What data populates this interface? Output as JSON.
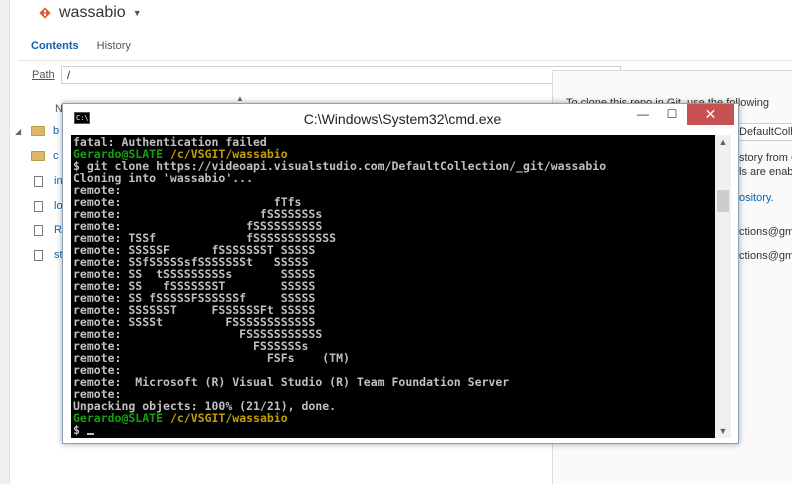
{
  "repo": {
    "name": "wassabio",
    "icon": "git-repo-icon"
  },
  "tabs": [
    {
      "label": "Contents",
      "active": true
    },
    {
      "label": "History",
      "active": false
    }
  ],
  "path": {
    "label": "Path",
    "value": "/"
  },
  "file_list": {
    "column_header": "N",
    "items": [
      {
        "label": "b",
        "type": "folder",
        "expanded": true
      },
      {
        "label": "c",
        "type": "folder"
      },
      {
        "label": "in",
        "type": "file"
      },
      {
        "label": "lo",
        "type": "file"
      },
      {
        "label": "R",
        "type": "file"
      },
      {
        "label": "st",
        "type": "file"
      }
    ]
  },
  "right_panel": {
    "lines": [
      "To clone this repo in Git, use the following",
      "DefaultColl",
      "story from C",
      "ls are enab",
      "ository.",
      "ctions@gm",
      "ctions@gm"
    ]
  },
  "cmd": {
    "title": "C:\\Windows\\System32\\cmd.exe",
    "icon_text": "C:\\",
    "controls": {
      "minimize": "—",
      "maximize": "☐",
      "close": "✕"
    },
    "lines": [
      {
        "text": "fatal: Authentication failed"
      },
      {
        "prompt_user": "Gerardo@SLATE",
        "prompt_path": "/c/VSGIT/wassabio"
      },
      {
        "text": "$ git clone https://videoapi.visualstudio.com/DefaultCollection/_git/wassabio"
      },
      {
        "text": "Cloning into 'wassabio'..."
      },
      {
        "text": "remote:"
      },
      {
        "text": "remote:                      fTfs"
      },
      {
        "text": "remote:                    fSSSSSSSs"
      },
      {
        "text": "remote:                  fSSSSSSSSSS"
      },
      {
        "text": "remote: TSSf             fSSSSSSSSSSSS"
      },
      {
        "text": "remote: SSSSSF      fSSSSSSST SSSSS"
      },
      {
        "text": "remote: SSfSSSSSsfSSSSSSSt   SSSSS"
      },
      {
        "text": "remote: SS  tSSSSSSSSSs       SSSSS"
      },
      {
        "text": "remote: SS   fSSSSSSST        SSSSS"
      },
      {
        "text": "remote: SS fSSSSSFSSSSSSf     SSSSS"
      },
      {
        "text": "remote: SSSSSST     FSSSSSSFt SSSSS"
      },
      {
        "text": "remote: SSSSt         FSSSSSSSSSSSS"
      },
      {
        "text": "remote:                 FSSSSSSSSSSS"
      },
      {
        "text": "remote:                   FSSSSSSs"
      },
      {
        "text": "remote:                     FSFs    (TM)"
      },
      {
        "text": "remote:"
      },
      {
        "text": "remote:  Microsoft (R) Visual Studio (R) Team Foundation Server"
      },
      {
        "text": "remote:"
      },
      {
        "text": "Unpacking objects: 100% (21/21), done."
      },
      {
        "prompt_user": "Gerardo@SLATE",
        "prompt_path": "/c/VSGIT/wassabio"
      },
      {
        "text": "$ ",
        "cursor": true
      }
    ]
  },
  "colors": {
    "accent": "#0a63b0",
    "console_bg": "#000000",
    "console_text": "#c0c0c0",
    "prompt_user": "#13a10e",
    "prompt_path": "#c1a000",
    "close_button": "#c75050"
  }
}
